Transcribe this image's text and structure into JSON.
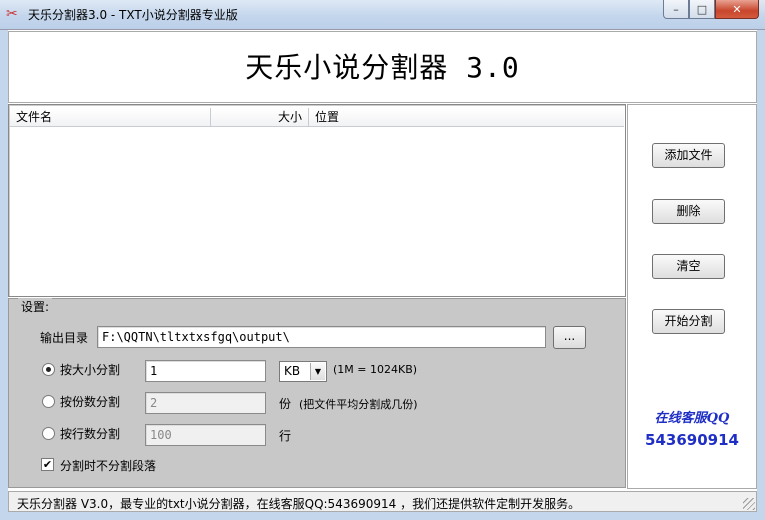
{
  "window": {
    "title": "天乐分割器3.0 - TXT小说分割器专业版",
    "min_symbol": "–",
    "max_symbol": "□",
    "close_symbol": "✕"
  },
  "banner": {
    "title": "天乐小说分割器 3.0"
  },
  "file_list": {
    "columns": [
      "文件名",
      "大小",
      "位置"
    ]
  },
  "settings": {
    "legend": "设置:",
    "output_dir_label": "输出目录",
    "output_dir_value": "F:\\QQTN\\tltxtxsfgq\\output\\",
    "browse_label": "...",
    "by_size_label": "按大小分割",
    "by_size_value": "1",
    "size_unit": "KB",
    "size_hint": "(1M = 1024KB)",
    "by_count_label": "按份数分割",
    "by_count_value": "2",
    "count_unit": "份",
    "count_hint": "(把文件平均分割成几份)",
    "by_lines_label": "按行数分割",
    "by_lines_value": "100",
    "lines_unit": "行",
    "no_split_paragraph_label": "分割时不分割段落",
    "selected_mode": "by_size",
    "no_split_paragraph_checked": true
  },
  "actions": {
    "add_file": "添加文件",
    "delete": "删除",
    "clear": "清空",
    "start_split": "开始分割"
  },
  "support": {
    "label": "在线客服QQ",
    "qq": "543690914"
  },
  "statusbar": {
    "text": "天乐分割器 V3.0，最专业的txt小说分割器，在线客服QQ:543690914 ，我们还提供软件定制开发服务。"
  },
  "colors": {
    "support_text": "#1f2fc6",
    "settings_bg": "#c8c8c8"
  }
}
